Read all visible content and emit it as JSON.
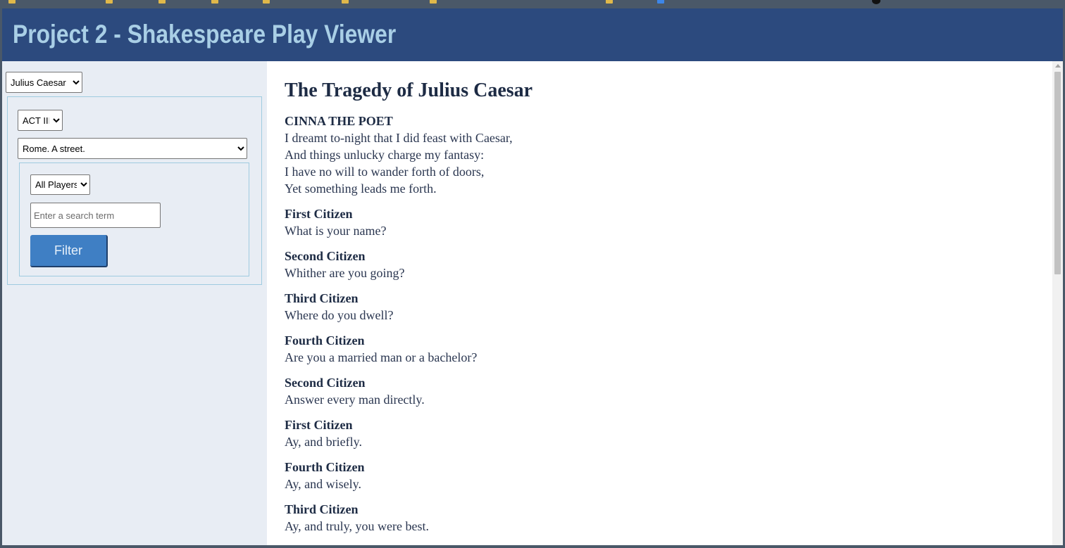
{
  "header": {
    "title": "Project 2 - Shakespeare Play Viewer"
  },
  "sidebar": {
    "play_select": {
      "selected": "Julius Caesar"
    },
    "act_select": {
      "selected": "ACT III"
    },
    "scene_select": {
      "selected": "Rome. A street."
    },
    "player_select": {
      "selected": "All Players"
    },
    "search": {
      "placeholder": "Enter a search term"
    },
    "filter_label": "Filter"
  },
  "content": {
    "title": "The Tragedy of Julius Caesar",
    "speeches": [
      {
        "speaker": "CINNA THE POET",
        "lines": [
          "I dreamt to-night that I did feast with Caesar,",
          "And things unlucky charge my fantasy:",
          "I have no will to wander forth of doors,",
          "Yet something leads me forth."
        ]
      },
      {
        "speaker": "First Citizen",
        "lines": [
          "What is your name?"
        ]
      },
      {
        "speaker": "Second Citizen",
        "lines": [
          "Whither are you going?"
        ]
      },
      {
        "speaker": "Third Citizen",
        "lines": [
          "Where do you dwell?"
        ]
      },
      {
        "speaker": "Fourth Citizen",
        "lines": [
          "Are you a married man or a bachelor?"
        ]
      },
      {
        "speaker": "Second Citizen",
        "lines": [
          "Answer every man directly."
        ]
      },
      {
        "speaker": "First Citizen",
        "lines": [
          "Ay, and briefly."
        ]
      },
      {
        "speaker": "Fourth Citizen",
        "lines": [
          "Ay, and wisely."
        ]
      },
      {
        "speaker": "Third Citizen",
        "lines": [
          "Ay, and truly, you were best."
        ]
      }
    ]
  },
  "colors": {
    "header_bg": "#2c4a7e",
    "header_text": "#a9cfe6",
    "sidebar_bg": "#e8edf4",
    "box_border": "#9fcbe0",
    "button_bg": "#3f7fc4"
  }
}
